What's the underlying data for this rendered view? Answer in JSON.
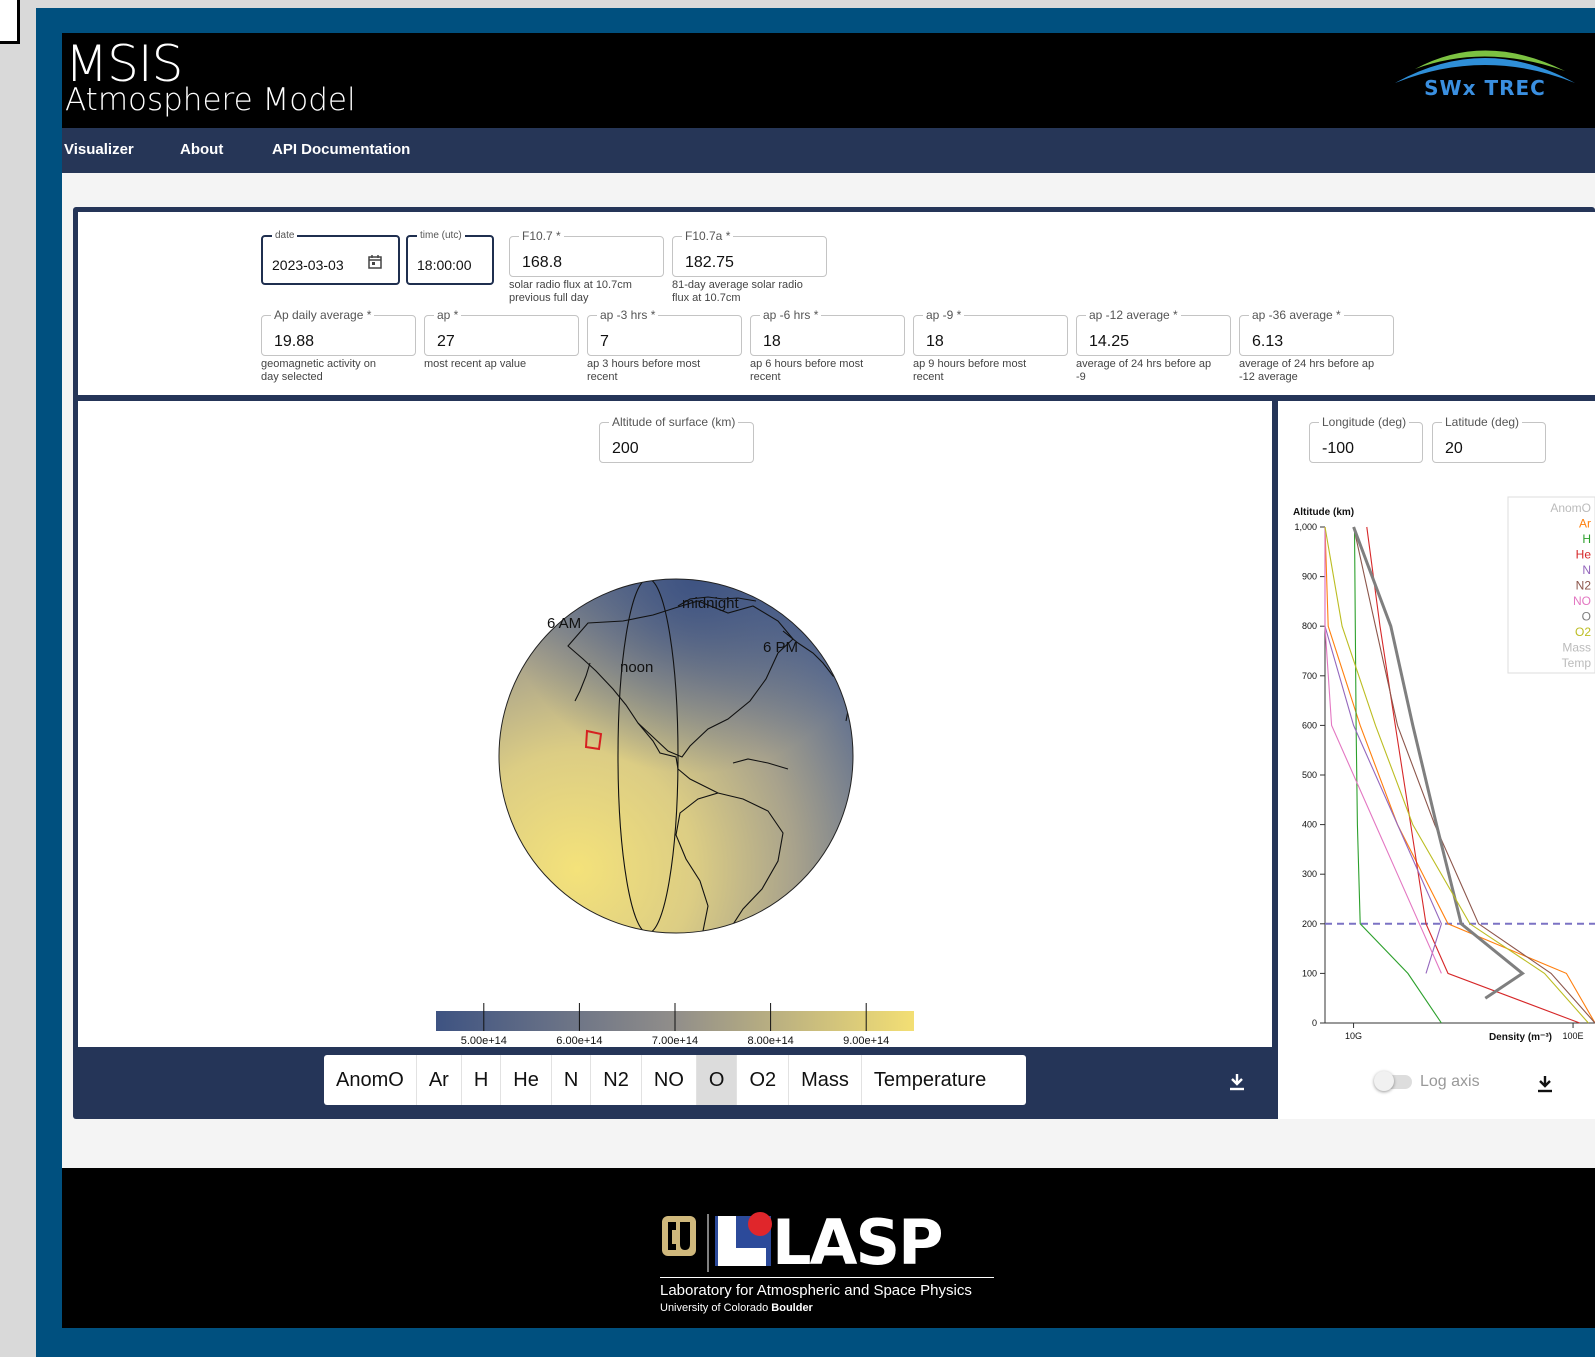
{
  "header": {
    "title": "MSIS",
    "subtitle": "Atmosphere Model",
    "logo_text": "SWx TREC"
  },
  "nav": {
    "items": [
      {
        "label": "Visualizer"
      },
      {
        "label": "About"
      },
      {
        "label": "API Documentation"
      }
    ]
  },
  "params": {
    "date": {
      "label": "date",
      "value": "2023-03-03"
    },
    "time": {
      "label": "time (utc)",
      "value": "18:00:00"
    },
    "f107": {
      "label": "F10.7 *",
      "value": "168.8",
      "help": [
        "solar radio flux at 10.7cm",
        "previous full day"
      ]
    },
    "f107a": {
      "label": "F10.7a *",
      "value": "182.75",
      "help": [
        "81-day average solar radio",
        "flux at 10.7cm"
      ]
    },
    "ap_row": [
      {
        "label": "Ap daily average *",
        "value": "19.88",
        "help": [
          "geomagnetic activity on",
          "day selected"
        ]
      },
      {
        "label": "ap *",
        "value": "27",
        "help": [
          "most recent ap value",
          ""
        ]
      },
      {
        "label": "ap -3 hrs *",
        "value": "7",
        "help": [
          "ap 3 hours before most",
          "recent"
        ]
      },
      {
        "label": "ap -6 hrs *",
        "value": "18",
        "help": [
          "ap 6 hours before most",
          "recent"
        ]
      },
      {
        "label": "ap -9 *",
        "value": "18",
        "help": [
          "ap 9 hours before most",
          "recent"
        ]
      },
      {
        "label": "ap -12 average *",
        "value": "14.25",
        "help": [
          "average of 24 hrs before ap",
          "-9"
        ]
      },
      {
        "label": "ap -36 average *",
        "value": "6.13",
        "help": [
          "average of 24 hrs before ap",
          "-12 average"
        ]
      }
    ]
  },
  "map": {
    "altitude": {
      "label": "Altitude of surface (km)",
      "value": "200"
    },
    "annotations": {
      "six_am": "6 AM",
      "midnight": "midnight",
      "noon": "noon",
      "six_pm": "6 PM"
    },
    "colorbar": {
      "ticks": [
        "5.00e+14",
        "6.00e+14",
        "7.00e+14",
        "8.00e+14",
        "9.00e+14"
      ],
      "tick_values": [
        500000000000000.0,
        600000000000000.0,
        700000000000000.0,
        800000000000000.0,
        900000000000000.0
      ],
      "range": [
        450000000000000.0,
        950000000000000.0
      ],
      "color_low": "#3e5382",
      "color_mid": "#918e8a",
      "color_high": "#f3df74"
    }
  },
  "species": {
    "buttons": [
      "AnomO",
      "Ar",
      "H",
      "He",
      "N",
      "N2",
      "NO",
      "O",
      "O2",
      "Mass",
      "Temperature"
    ],
    "selected": "O"
  },
  "profile": {
    "longitude": {
      "label": "Longitude (deg)",
      "value": "-100"
    },
    "latitude": {
      "label": "Latitude (deg)",
      "value": "20"
    },
    "log_axis_label": "Log axis",
    "log_axis_on": false
  },
  "chart_data": {
    "type": "line",
    "ylabel": "Altitude (km)",
    "xlabel": "Density (m⁻³)",
    "y_ticks": [
      0,
      100,
      200,
      300,
      400,
      500,
      600,
      700,
      800,
      900,
      1000
    ],
    "y_tick_labels": [
      "0",
      "100",
      "200",
      "300",
      "400",
      "500",
      "600",
      "700",
      "800",
      "900",
      "1,000"
    ],
    "x_ticks": [
      10000000000,
      100000000000000000000
    ],
    "x_tick_labels": [
      "10G",
      "100E"
    ],
    "x_scale": "log",
    "xlim": [
      500000000.0,
      1e+21
    ],
    "ylim": [
      0,
      1000
    ],
    "surface_altitude": 200,
    "legend": [
      "AnomO",
      "Ar",
      "H",
      "He",
      "N",
      "N2",
      "NO",
      "O",
      "O2",
      "Mass",
      "Temp"
    ],
    "series": [
      {
        "name": "Ar",
        "color": "#ff7f0e",
        "y": [
          0,
          100,
          200,
          400,
          600,
          800,
          1000
        ],
        "x": [
          1e+21,
          5e+19,
          200000000000000.0,
          1000000000000.0,
          20000000000.0,
          700000000.0,
          20000000.0
        ]
      },
      {
        "name": "H",
        "color": "#2ca02c",
        "y": [
          0,
          100,
          200,
          400,
          600,
          800,
          1000
        ],
        "x": [
          100000000000000.0,
          3000000000000.0,
          20000000000.0,
          15000000000.0,
          13000000000.0,
          12000000000.0,
          11000000000.0
        ]
      },
      {
        "name": "He",
        "color": "#d62728",
        "y": [
          0,
          100,
          200,
          400,
          600,
          800,
          1000
        ],
        "x": [
          2e+20,
          200000000000000.0,
          20000000000000.0,
          4000000000000.0,
          800000000000.0,
          160000000000.0,
          40000000000.0
        ]
      },
      {
        "name": "N",
        "color": "#9467bd",
        "y": [
          100,
          200,
          400,
          600,
          800,
          1000
        ],
        "x": [
          20000000000000.0,
          100000000000000.0,
          1000000000000.0,
          10000000000.0,
          150000000.0,
          10000000.0
        ]
      },
      {
        "name": "N2",
        "color": "#8c564b",
        "y": [
          0,
          100,
          200,
          400,
          600,
          800,
          1000
        ],
        "x": [
          1e+21,
          1e+19,
          5000000000000000.0,
          50000000000000.0,
          1000000000000.0,
          100000000000.0,
          10000000000.0
        ]
      },
      {
        "name": "NO",
        "color": "#e377c2",
        "y": [
          100,
          200,
          400,
          600,
          800,
          1000
        ],
        "x": [
          100000000000000.0,
          10000000000000.0,
          100000000000.0,
          1000000000.0,
          10000000.0,
          1000000.0
        ]
      },
      {
        "name": "O",
        "color": "#7f7f7f",
        "y": [
          50,
          100,
          200,
          400,
          600,
          800,
          1000
        ],
        "x": [
          1e+16,
          5e+17,
          800000000000000.0,
          60000000000000.0,
          5000000000000.0,
          500000000000.0,
          10000000000.0
        ]
      },
      {
        "name": "O2",
        "color": "#bcbd22",
        "y": [
          0,
          100,
          200,
          400,
          600,
          800,
          1000
        ],
        "x": [
          5e+20,
          5e+18,
          2000000000000000.0,
          5000000000000.0,
          100000000000.0,
          3000000000.0,
          100000000.0
        ]
      }
    ]
  },
  "footer": {
    "org_line1": "Laboratory for Atmospheric and Space Physics",
    "org_line2_prefix": "University of Colorado ",
    "org_line2_bold": "Boulder",
    "lasp_logo_text": "LASP"
  }
}
